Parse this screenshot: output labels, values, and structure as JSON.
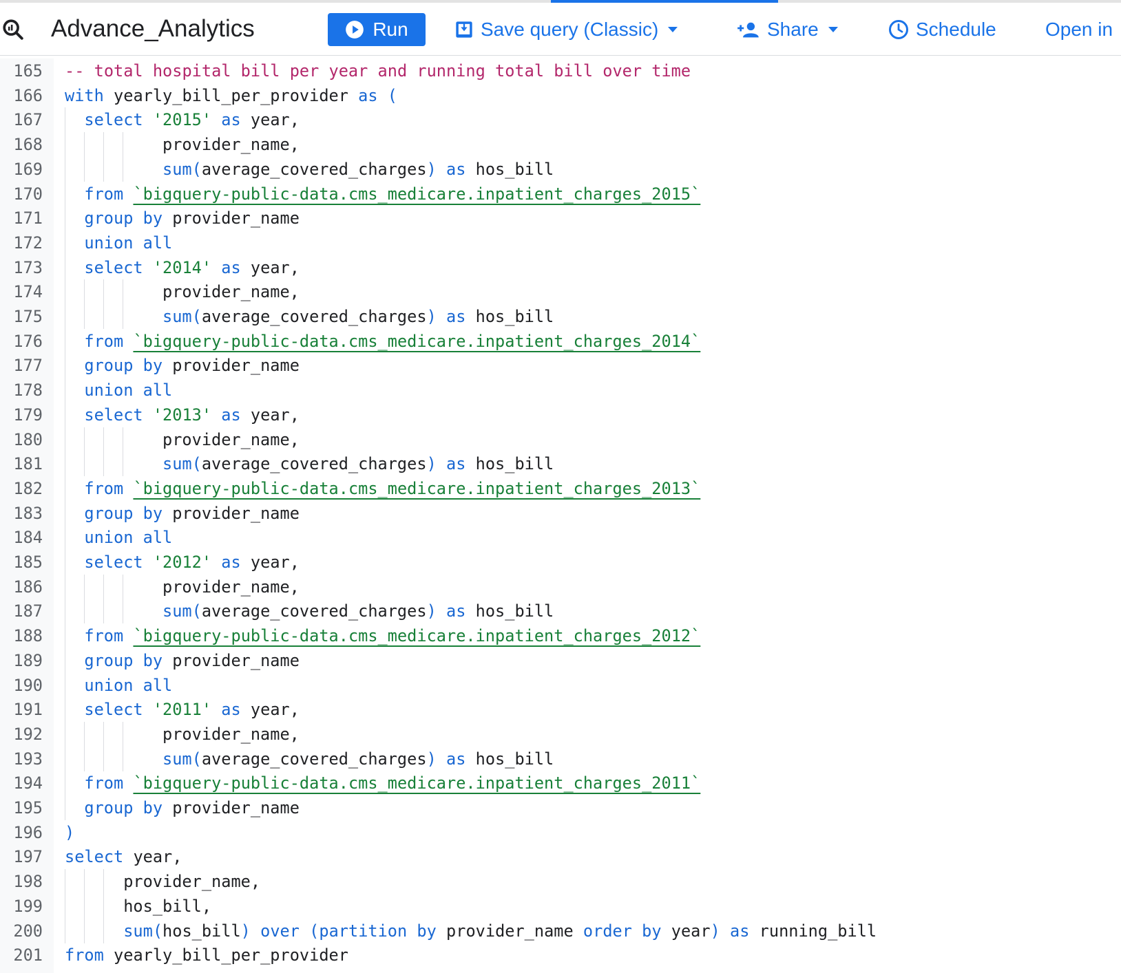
{
  "toolbar": {
    "tab_title": "Advance_Analytics",
    "run_label": "Run",
    "save_label": "Save query (Classic)",
    "share_label": "Share",
    "schedule_label": "Schedule",
    "open_label": "Open in"
  },
  "colors": {
    "accent": "#1a73e8",
    "keyword": "#1967d2",
    "string": "#188038",
    "comment": "#b3276b"
  },
  "editor": {
    "lines": [
      {
        "n": "165",
        "indent": 0,
        "guides": 0,
        "tokens": [
          [
            "com",
            "-- total hospital bill per year and running total bill over time"
          ]
        ]
      },
      {
        "n": "166",
        "indent": 0,
        "guides": 0,
        "tokens": [
          [
            "kw",
            "with"
          ],
          [
            "id",
            " yearly_bill_per_provider "
          ],
          [
            "kw",
            "as"
          ],
          [
            "id",
            " "
          ],
          [
            "op",
            "("
          ]
        ]
      },
      {
        "n": "167",
        "indent": 2,
        "guides": 1,
        "tokens": [
          [
            "kw",
            "select"
          ],
          [
            "id",
            " "
          ],
          [
            "str",
            "'2015'"
          ],
          [
            "id",
            " "
          ],
          [
            "kw",
            "as"
          ],
          [
            "id",
            " year,"
          ]
        ]
      },
      {
        "n": "168",
        "indent": 10,
        "guides": 4,
        "tokens": [
          [
            "id",
            "provider_name,"
          ]
        ]
      },
      {
        "n": "169",
        "indent": 10,
        "guides": 4,
        "tokens": [
          [
            "fn",
            "sum"
          ],
          [
            "op",
            "("
          ],
          [
            "id",
            "average_covered_charges"
          ],
          [
            "op",
            ")"
          ],
          [
            "id",
            " "
          ],
          [
            "kw",
            "as"
          ],
          [
            "id",
            " hos_bill"
          ]
        ]
      },
      {
        "n": "170",
        "indent": 2,
        "guides": 1,
        "tokens": [
          [
            "kw",
            "from"
          ],
          [
            "id",
            " "
          ],
          [
            "tbl",
            "`bigquery-public-data.cms_medicare.inpatient_charges_2015`"
          ]
        ]
      },
      {
        "n": "171",
        "indent": 2,
        "guides": 1,
        "tokens": [
          [
            "kw",
            "group by"
          ],
          [
            "id",
            " provider_name"
          ]
        ]
      },
      {
        "n": "172",
        "indent": 2,
        "guides": 1,
        "tokens": [
          [
            "kw",
            "union all"
          ]
        ]
      },
      {
        "n": "173",
        "indent": 2,
        "guides": 1,
        "tokens": [
          [
            "kw",
            "select"
          ],
          [
            "id",
            " "
          ],
          [
            "str",
            "'2014'"
          ],
          [
            "id",
            " "
          ],
          [
            "kw",
            "as"
          ],
          [
            "id",
            " year,"
          ]
        ]
      },
      {
        "n": "174",
        "indent": 10,
        "guides": 4,
        "tokens": [
          [
            "id",
            "provider_name,"
          ]
        ]
      },
      {
        "n": "175",
        "indent": 10,
        "guides": 4,
        "tokens": [
          [
            "fn",
            "sum"
          ],
          [
            "op",
            "("
          ],
          [
            "id",
            "average_covered_charges"
          ],
          [
            "op",
            ")"
          ],
          [
            "id",
            " "
          ],
          [
            "kw",
            "as"
          ],
          [
            "id",
            " hos_bill"
          ]
        ]
      },
      {
        "n": "176",
        "indent": 2,
        "guides": 1,
        "tokens": [
          [
            "kw",
            "from"
          ],
          [
            "id",
            " "
          ],
          [
            "tbl",
            "`bigquery-public-data.cms_medicare.inpatient_charges_2014`"
          ]
        ]
      },
      {
        "n": "177",
        "indent": 2,
        "guides": 1,
        "tokens": [
          [
            "kw",
            "group by"
          ],
          [
            "id",
            " provider_name"
          ]
        ]
      },
      {
        "n": "178",
        "indent": 2,
        "guides": 1,
        "tokens": [
          [
            "kw",
            "union all"
          ]
        ]
      },
      {
        "n": "179",
        "indent": 2,
        "guides": 1,
        "tokens": [
          [
            "kw",
            "select"
          ],
          [
            "id",
            " "
          ],
          [
            "str",
            "'2013'"
          ],
          [
            "id",
            " "
          ],
          [
            "kw",
            "as"
          ],
          [
            "id",
            " year,"
          ]
        ]
      },
      {
        "n": "180",
        "indent": 10,
        "guides": 4,
        "tokens": [
          [
            "id",
            "provider_name,"
          ]
        ]
      },
      {
        "n": "181",
        "indent": 10,
        "guides": 4,
        "tokens": [
          [
            "fn",
            "sum"
          ],
          [
            "op",
            "("
          ],
          [
            "id",
            "average_covered_charges"
          ],
          [
            "op",
            ")"
          ],
          [
            "id",
            " "
          ],
          [
            "kw",
            "as"
          ],
          [
            "id",
            " hos_bill"
          ]
        ]
      },
      {
        "n": "182",
        "indent": 2,
        "guides": 1,
        "tokens": [
          [
            "kw",
            "from"
          ],
          [
            "id",
            " "
          ],
          [
            "tbl",
            "`bigquery-public-data.cms_medicare.inpatient_charges_2013`"
          ]
        ]
      },
      {
        "n": "183",
        "indent": 2,
        "guides": 1,
        "tokens": [
          [
            "kw",
            "group by"
          ],
          [
            "id",
            " provider_name"
          ]
        ]
      },
      {
        "n": "184",
        "indent": 2,
        "guides": 1,
        "tokens": [
          [
            "kw",
            "union all"
          ]
        ]
      },
      {
        "n": "185",
        "indent": 2,
        "guides": 1,
        "tokens": [
          [
            "kw",
            "select"
          ],
          [
            "id",
            " "
          ],
          [
            "str",
            "'2012'"
          ],
          [
            "id",
            " "
          ],
          [
            "kw",
            "as"
          ],
          [
            "id",
            " year,"
          ]
        ]
      },
      {
        "n": "186",
        "indent": 10,
        "guides": 4,
        "tokens": [
          [
            "id",
            "provider_name,"
          ]
        ]
      },
      {
        "n": "187",
        "indent": 10,
        "guides": 4,
        "tokens": [
          [
            "fn",
            "sum"
          ],
          [
            "op",
            "("
          ],
          [
            "id",
            "average_covered_charges"
          ],
          [
            "op",
            ")"
          ],
          [
            "id",
            " "
          ],
          [
            "kw",
            "as"
          ],
          [
            "id",
            " hos_bill"
          ]
        ]
      },
      {
        "n": "188",
        "indent": 2,
        "guides": 1,
        "tokens": [
          [
            "kw",
            "from"
          ],
          [
            "id",
            " "
          ],
          [
            "tbl",
            "`bigquery-public-data.cms_medicare.inpatient_charges_2012`"
          ]
        ]
      },
      {
        "n": "189",
        "indent": 2,
        "guides": 1,
        "tokens": [
          [
            "kw",
            "group by"
          ],
          [
            "id",
            " provider_name"
          ]
        ]
      },
      {
        "n": "190",
        "indent": 2,
        "guides": 1,
        "tokens": [
          [
            "kw",
            "union all"
          ]
        ]
      },
      {
        "n": "191",
        "indent": 2,
        "guides": 1,
        "tokens": [
          [
            "kw",
            "select"
          ],
          [
            "id",
            " "
          ],
          [
            "str",
            "'2011'"
          ],
          [
            "id",
            " "
          ],
          [
            "kw",
            "as"
          ],
          [
            "id",
            " year,"
          ]
        ]
      },
      {
        "n": "192",
        "indent": 10,
        "guides": 4,
        "tokens": [
          [
            "id",
            "provider_name,"
          ]
        ]
      },
      {
        "n": "193",
        "indent": 10,
        "guides": 4,
        "tokens": [
          [
            "fn",
            "sum"
          ],
          [
            "op",
            "("
          ],
          [
            "id",
            "average_covered_charges"
          ],
          [
            "op",
            ")"
          ],
          [
            "id",
            " "
          ],
          [
            "kw",
            "as"
          ],
          [
            "id",
            " hos_bill"
          ]
        ]
      },
      {
        "n": "194",
        "indent": 2,
        "guides": 1,
        "tokens": [
          [
            "kw",
            "from"
          ],
          [
            "id",
            " "
          ],
          [
            "tbl",
            "`bigquery-public-data.cms_medicare.inpatient_charges_2011`"
          ]
        ]
      },
      {
        "n": "195",
        "indent": 2,
        "guides": 1,
        "tokens": [
          [
            "kw",
            "group by"
          ],
          [
            "id",
            " provider_name"
          ]
        ]
      },
      {
        "n": "196",
        "indent": 0,
        "guides": 0,
        "tokens": [
          [
            "op",
            ")"
          ]
        ]
      },
      {
        "n": "197",
        "indent": 0,
        "guides": 0,
        "tokens": [
          [
            "kw",
            "select"
          ],
          [
            "id",
            " year,"
          ]
        ]
      },
      {
        "n": "198",
        "indent": 6,
        "guides": 3,
        "tokens": [
          [
            "id",
            "provider_name,"
          ]
        ]
      },
      {
        "n": "199",
        "indent": 6,
        "guides": 3,
        "tokens": [
          [
            "id",
            "hos_bill,"
          ]
        ]
      },
      {
        "n": "200",
        "indent": 6,
        "guides": 3,
        "tokens": [
          [
            "fn",
            "sum"
          ],
          [
            "op",
            "("
          ],
          [
            "id",
            "hos_bill"
          ],
          [
            "op",
            ")"
          ],
          [
            "id",
            " "
          ],
          [
            "kw",
            "over"
          ],
          [
            "id",
            " "
          ],
          [
            "op",
            "("
          ],
          [
            "kw",
            "partition by"
          ],
          [
            "id",
            " provider_name "
          ],
          [
            "kw",
            "order by"
          ],
          [
            "id",
            " year"
          ],
          [
            "op",
            ")"
          ],
          [
            "id",
            " "
          ],
          [
            "kw",
            "as"
          ],
          [
            "id",
            " running_bill"
          ]
        ]
      },
      {
        "n": "201",
        "indent": 0,
        "guides": 0,
        "tokens": [
          [
            "kw",
            "from"
          ],
          [
            "id",
            " yearly_bill_per_provider"
          ]
        ]
      }
    ]
  }
}
